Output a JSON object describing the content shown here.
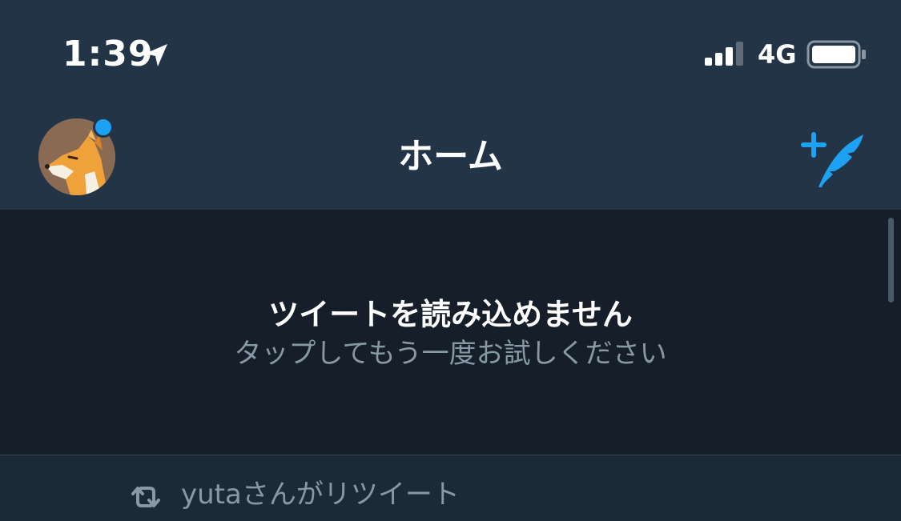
{
  "status_bar": {
    "time": "1:39",
    "network": "4G",
    "location_icon": "location-arrow-icon",
    "signal_icon": "cellular-signal-icon",
    "battery_icon": "battery-icon"
  },
  "header": {
    "title": "ホーム",
    "avatar_icon": "fox-avatar",
    "compose_icon": "compose-tweet-icon",
    "notification_dot_color": "#1da1f2"
  },
  "timeline": {
    "error_title": "ツイートを読み込めません",
    "error_subtitle": "タップしてもう一度お試しください"
  },
  "tweet": {
    "retweet_label": "yutaさんがリツイート",
    "retweet_icon": "retweet-icon"
  },
  "colors": {
    "header_bg": "#243447",
    "content_bg": "#161f29",
    "accent": "#1da1f2",
    "secondary_text": "#8899a6"
  }
}
